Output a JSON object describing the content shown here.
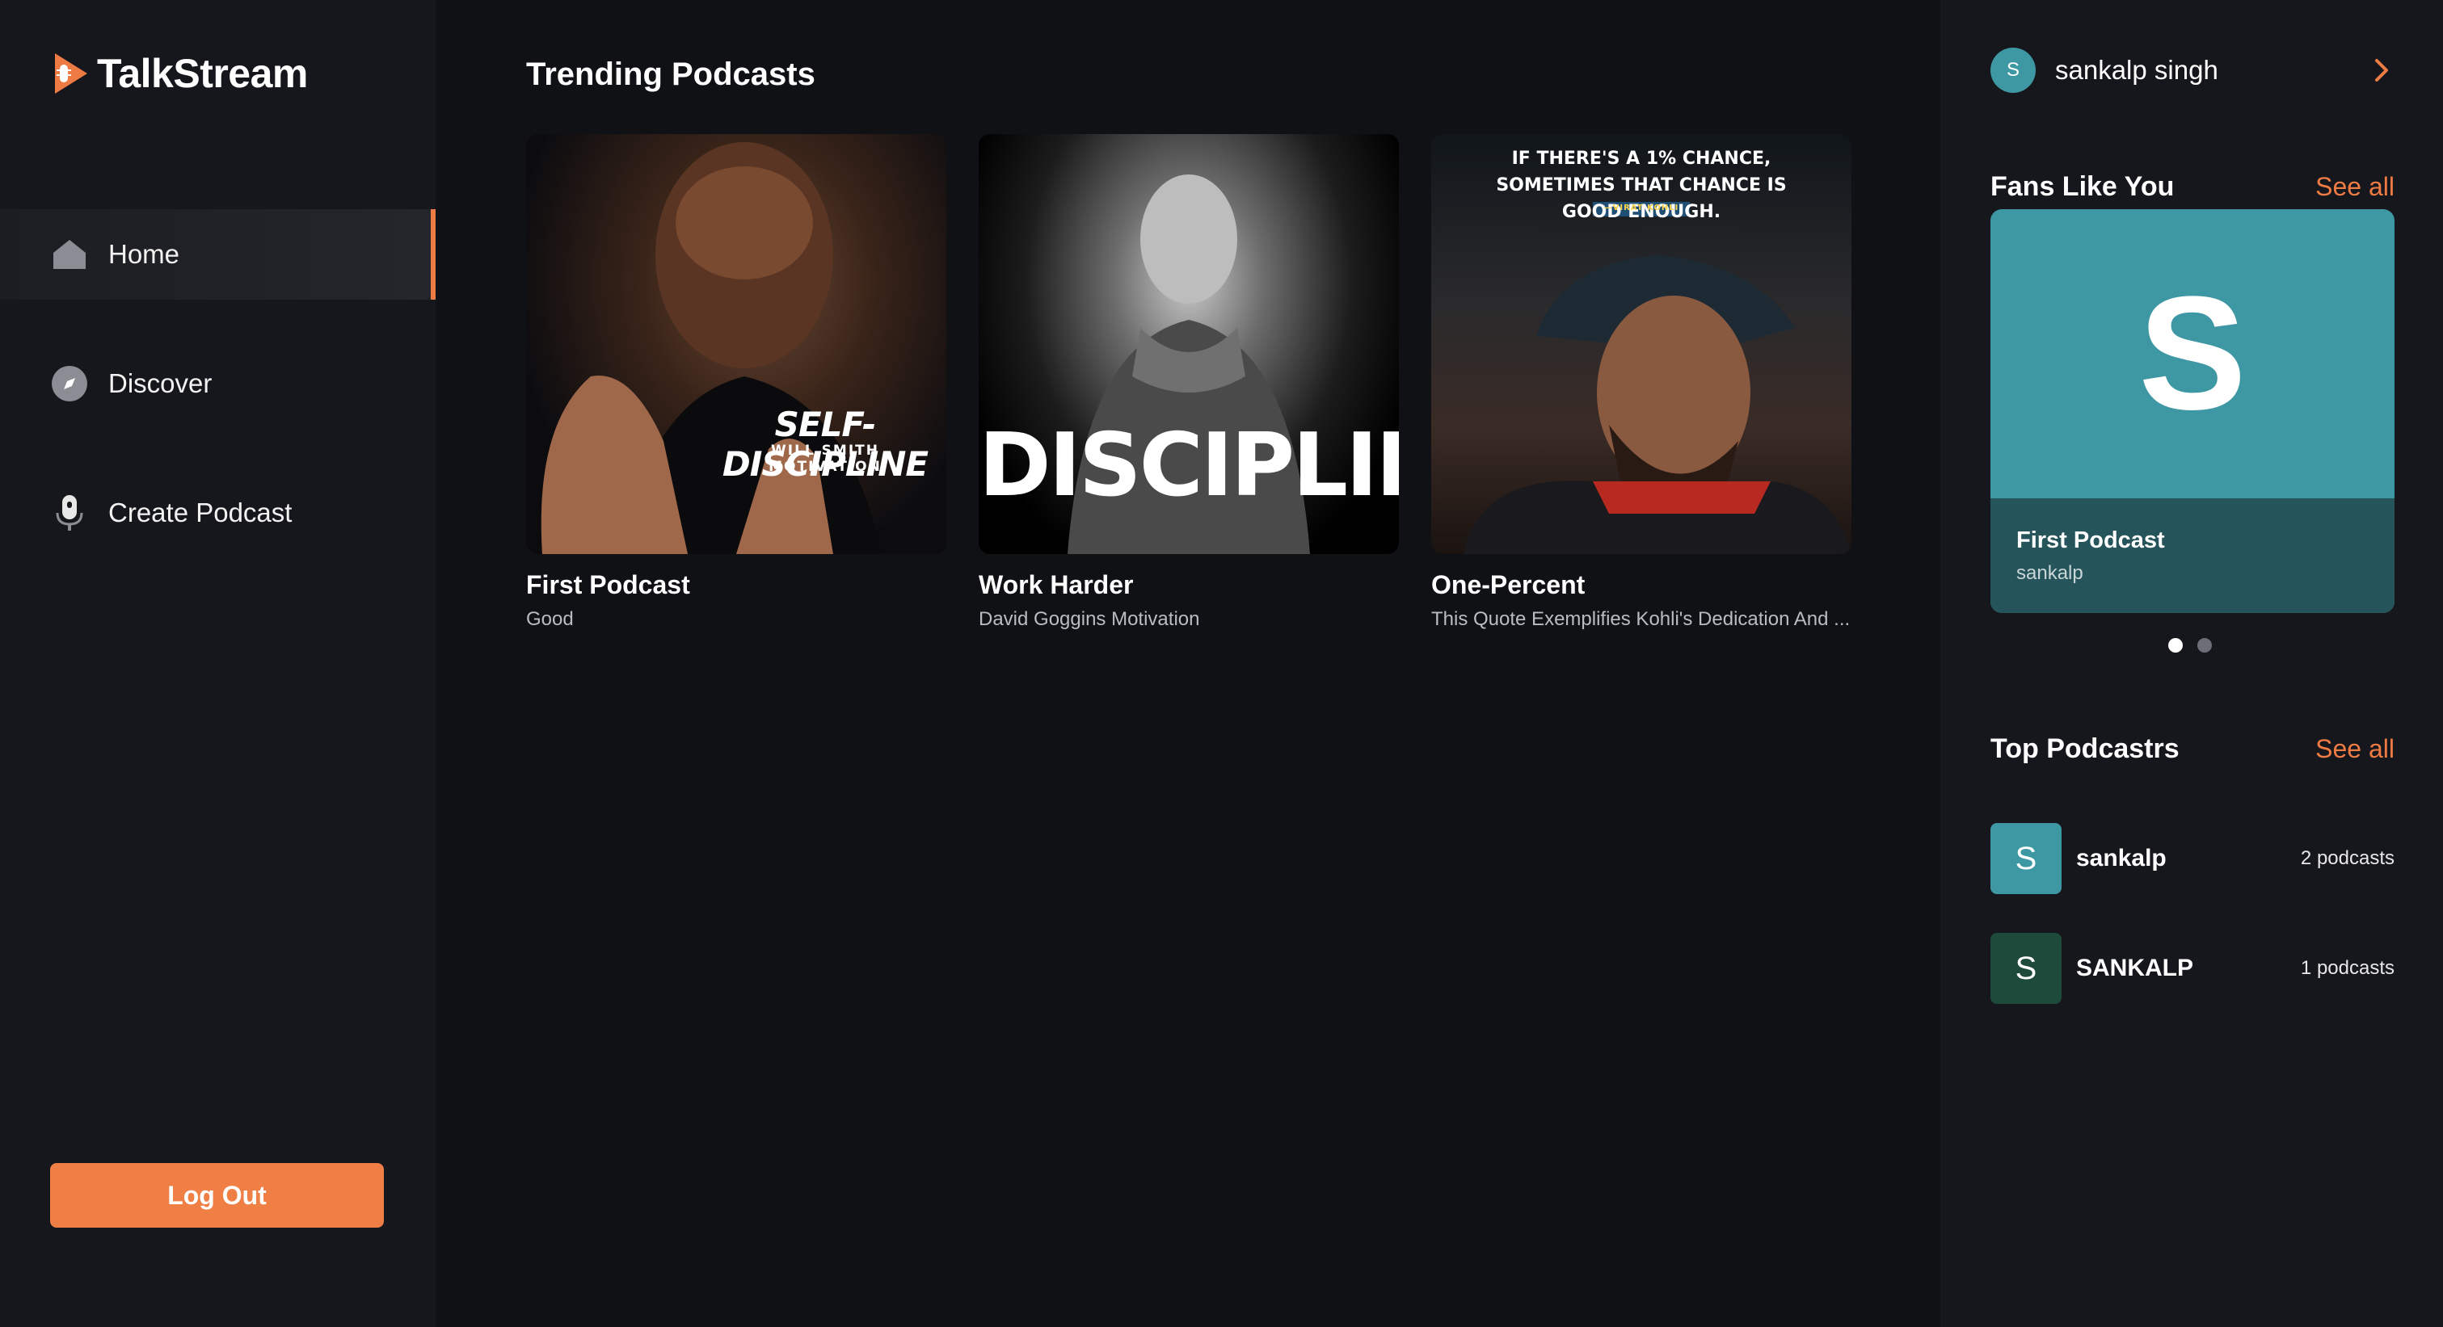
{
  "brand": {
    "name": "TalkStream"
  },
  "sidebar": {
    "items": [
      {
        "label": "Home",
        "icon": "home-icon",
        "active": true
      },
      {
        "label": "Discover",
        "icon": "compass-icon",
        "active": false
      },
      {
        "label": "Create Podcast",
        "icon": "microphone-icon",
        "active": false
      }
    ],
    "logout_label": "Log Out"
  },
  "main": {
    "section_title": "Trending Podcasts",
    "cards": [
      {
        "title": "First Podcast",
        "subtitle": "Good",
        "thumb_text_main": "SELF-DISCIPLINE",
        "thumb_text_sub": "WILL SMITH MOTIVATION"
      },
      {
        "title": "Work Harder",
        "subtitle": "David Goggins Motivation",
        "thumb_text_main": "DISCIPLINE"
      },
      {
        "title": "One-Percent",
        "subtitle": "This Quote Exemplifies Kohli's Dedication And ...",
        "thumb_text_main": "IF THERE'S A 1% CHANCE, SOMETIMES THAT CHANCE IS GOOD ENOUGH.",
        "thumb_text_sub": "—VIRAT KOHLI"
      }
    ]
  },
  "right": {
    "user": {
      "initial": "S",
      "name": "sankalp singh"
    },
    "fans": {
      "heading": "Fans Like You",
      "see_all": "See all",
      "card": {
        "letter": "S",
        "title": "First Podcast",
        "author": "sankalp"
      },
      "carousel_dots": 2,
      "active_dot": 0
    },
    "top": {
      "heading": "Top Podcastrs",
      "see_all": "See all",
      "items": [
        {
          "initial": "S",
          "name": "sankalp",
          "count": "2 podcasts",
          "color": "#3e98a4"
        },
        {
          "initial": "S",
          "name": "SANKALP",
          "count": "1 podcasts",
          "color": "#1e4a3c"
        }
      ]
    }
  },
  "colors": {
    "accent": "#ee7b43",
    "teal": "#3e98a4",
    "sidebar_bg": "#15171c",
    "main_bg": "#101114"
  }
}
